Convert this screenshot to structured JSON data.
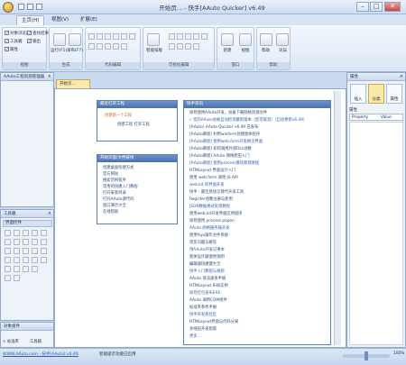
{
  "window": {
    "title": "开始页... - 快手[AAuto Quicker] v6.49",
    "min": "–",
    "max": "□",
    "close": "✕"
  },
  "ribbon_tabs": [
    "主页(H)",
    "视图(V)",
    "扩展(E)"
  ],
  "ribbon_groups": {
    "view": {
      "label": "视图",
      "checks": [
        "对象浏览器",
        "工具箱",
        "属性",
        "查找结果",
        "输出"
      ]
    },
    "build": {
      "label": "生成",
      "buttons": [
        "运行(F5)",
        "发布(F7)"
      ]
    },
    "code": {
      "label": "代码编辑"
    },
    "visual": {
      "label": "可视化编辑",
      "buttons": [
        "智能排版",
        "控件",
        "文本"
      ]
    },
    "window": {
      "label": "窗口",
      "buttons": [
        "新建",
        "视图"
      ]
    },
    "help": {
      "label": "帮助",
      "buttons": [
        "帮助",
        "论坛"
      ]
    }
  },
  "left_top_panel": {
    "title": "AAuto工程资源管理器"
  },
  "left_mid_panel": {
    "title": "工具箱",
    "section": "界面控件"
  },
  "left_bottom_panel": {
    "title": "对象组件",
    "tabs": [
      "+ 标准库",
      "工具箱"
    ]
  },
  "document": {
    "tab": "开始页...",
    "recent_card": {
      "title": "最近打开工程",
      "link1": "创建新一个工程",
      "link2": "创建工程  打开工程"
    },
    "learn_card": {
      "title": "开始页面/文档链接",
      "items": [
        "创建桌面快捷方式",
        "官方网站",
        "搜索范例程序",
        "常用的快捷入门教程",
        "打开安装目录",
        "打开AAuto源代码",
        "窗口演示大全",
        "在线帮助"
      ]
    },
    "news_card": {
      "title": "快手资讯",
      "lines": [
        "如何使用AAuto开发，准备下载网络资源文件",
        "√ 您的AAuto会被自动检测最新版本（您可取消）（自动更新v6.49）",
        "[AAuto] AAuto Quicker v6.49 已发布",
        "[AAuto教程] 利用winform创建窗体程序",
        "[AAuto教程] 使用web.form开发网页界面",
        "[AAuto教程] 如何调用外部DLL函数",
        "[AAuto教程] AAuto 网络爬虫入门",
        "[AAuto教程] 使用process模块管理进程",
        "HTMLayout 界面设计入门",
        "使用 web.form 调用 JS API",
        "web.kit 的界面开发",
        "快手 - 最佳易语言替代开发工具",
        "Register函数注册与使用",
        "JSON数据格式处理教程",
        "使用web.kit开发界面应用程序",
        "如何使用 process.popen",
        "AAuto 网络服务器开发",
        "使用fsys操作文件系统",
        "常见问题与解答",
        "用AAuto开发记事本",
        "窗体设计器使用说明",
        "编辑器快捷键大全",
        "快手入门教程与视频",
        "AAuto 语法速查手册",
        "HTMLayout 布局实例",
        "如何打包发布EXE",
        "AAuto 调用COM组件",
        "标准库参考手册",
        "快手开发者社区",
        "HTMLayout界面与代码分离",
        "多线程开发指南",
        "更多..."
      ]
    }
  },
  "right_panel": {
    "title": "属性",
    "tabs": [
      "插入",
      "分类",
      "属性"
    ],
    "section": "属性",
    "columns": [
      "Property",
      "Value"
    ]
  },
  "statusbar": {
    "link": "WWW.AAuto.com - 快手[AAuto] v6.49",
    "message": "智能提示功能已启用",
    "zoom": "100%"
  }
}
